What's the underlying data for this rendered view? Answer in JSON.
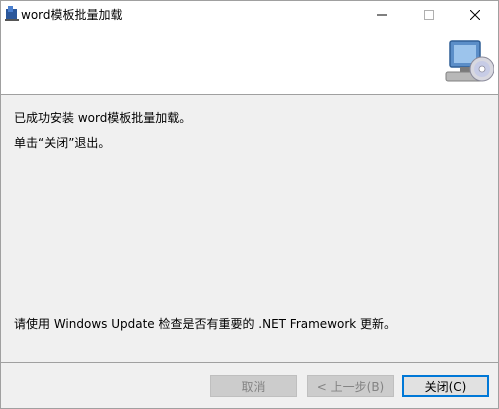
{
  "window": {
    "title": "word模板批量加载",
    "controls": {
      "minimize_icon": "minimize-icon",
      "maximize_icon": "maximize-icon",
      "close_icon": "close-icon"
    }
  },
  "header": {
    "icon": "computer-disc-icon"
  },
  "body": {
    "line1": "已成功安装 word模板批量加载。",
    "line2": "单击“关闭”退出。",
    "line3": "请使用 Windows Update 检查是否有重要的 .NET Framework 更新。"
  },
  "buttons": {
    "cancel": "取消",
    "back": "< 上一步(B)",
    "close": "关闭(C)"
  },
  "colors": {
    "accent": "#0078d7",
    "disabled_bg": "#cccccc",
    "disabled_text": "#838383"
  }
}
